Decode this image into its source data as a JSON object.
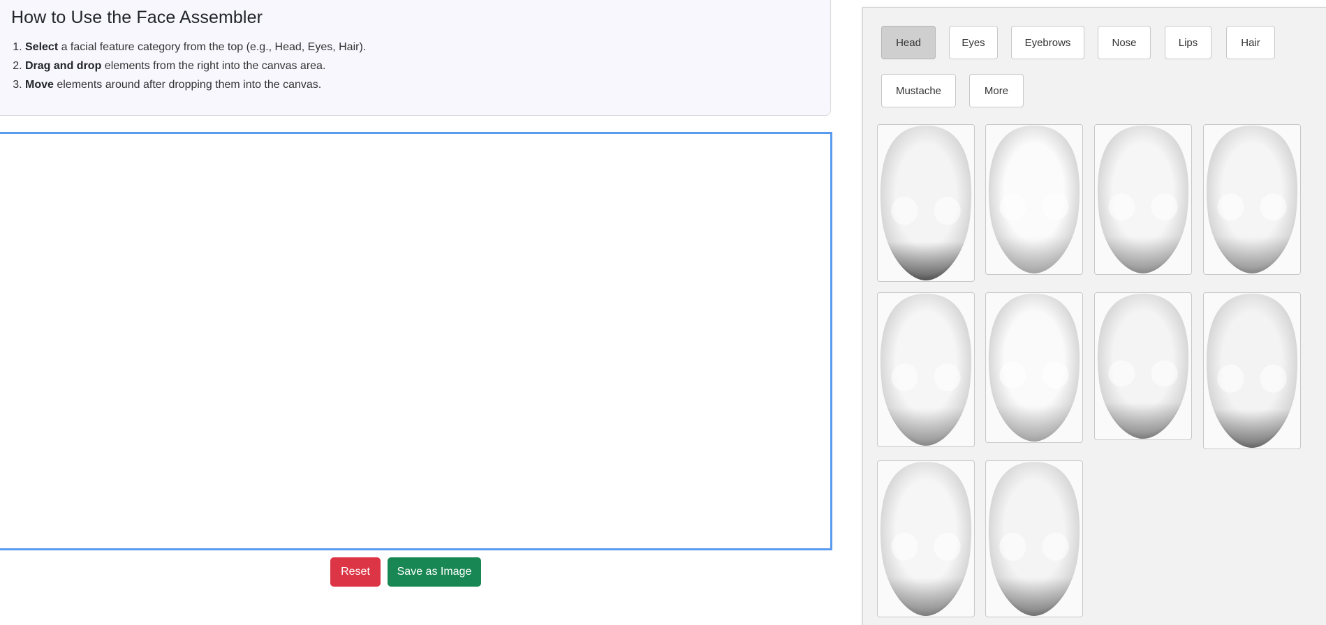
{
  "instructions": {
    "title": "How to Use the Face Assembler",
    "steps": [
      {
        "bold": "Select",
        "rest": " a facial feature category from the top (e.g., Head, Eyes, Hair)."
      },
      {
        "bold": "Drag and drop",
        "rest": " elements from the right into the canvas area."
      },
      {
        "bold": "Move",
        "rest": " elements around after dropping them into the canvas."
      }
    ]
  },
  "actions": {
    "reset_label": "Reset",
    "save_label": "Save as Image"
  },
  "colors": {
    "reset": "#dc3545",
    "save": "#198754",
    "canvas_border": "#5b9bef"
  },
  "categories": {
    "active": "Head",
    "items": [
      "Head",
      "Eyes",
      "Eyebrows",
      "Nose",
      "Lips",
      "Hair",
      "Mustache",
      "More"
    ]
  },
  "elements": {
    "category": "Head",
    "count": 10,
    "item_icon": "head-shape-icon"
  }
}
